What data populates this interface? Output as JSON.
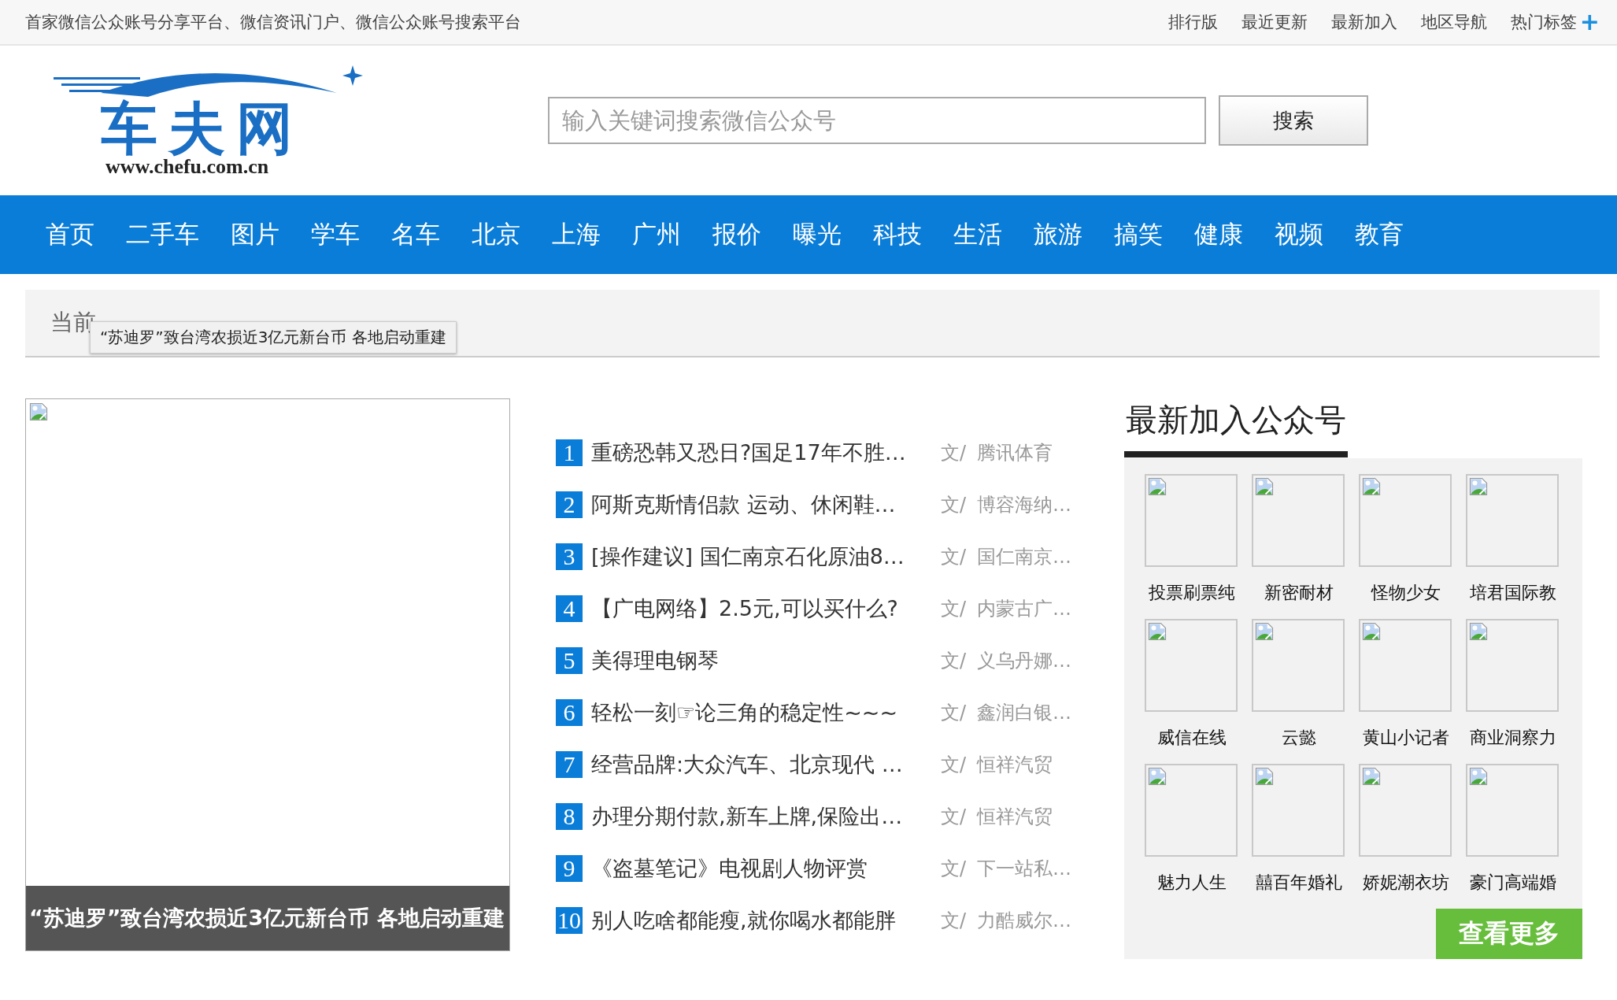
{
  "top_bar": {
    "slogan": "首家微信公众账号分享平台、微信资讯门户、微信公众账号搜索平台",
    "links": [
      "排行版",
      "最近更新",
      "最新加入",
      "地区导航",
      "热门标签"
    ],
    "plus": "+"
  },
  "logo": {
    "name": "车夫网",
    "url": "www.chefu.com.cn"
  },
  "search": {
    "placeholder": "输入关键词搜索微信公众号",
    "button": "搜索"
  },
  "nav": [
    "首页",
    "二手车",
    "图片",
    "学车",
    "名车",
    "北京",
    "上海",
    "广州",
    "报价",
    "曝光",
    "科技",
    "生活",
    "旅游",
    "搞笑",
    "健康",
    "视频",
    "教育"
  ],
  "breadcrumb": {
    "visible_text": "当前",
    "tooltip": "“苏迪罗”致台湾农损近3亿元新台币 各地启动重建"
  },
  "featured": {
    "caption": "“苏迪罗”致台湾农损近3亿元新台币 各地启动重建"
  },
  "news": [
    {
      "rank": "1",
      "title": "重磅恐韩又恐日?国足17年不胜…",
      "by": "文/",
      "source": "腾讯体育"
    },
    {
      "rank": "2",
      "title": "阿斯克斯情侣款 运动、休闲鞋…",
      "by": "文/",
      "source": "博容海纳…"
    },
    {
      "rank": "3",
      "title": "[操作建议] 国仁南京石化原油8…",
      "by": "文/",
      "source": "国仁南京…"
    },
    {
      "rank": "4",
      "title": "【广电网络】2.5元,可以买什么?",
      "by": "文/",
      "source": "内蒙古广…"
    },
    {
      "rank": "5",
      "title": "美得理电钢琴",
      "by": "文/",
      "source": "义乌丹娜…"
    },
    {
      "rank": "6",
      "title": "轻松一刻☞论三角的稳定性~~~",
      "by": "文/",
      "source": "鑫润白银…"
    },
    {
      "rank": "7",
      "title": "经营品牌:大众汽车、北京现代 …",
      "by": "文/",
      "source": "恒祥汽贸"
    },
    {
      "rank": "8",
      "title": "办理分期付款,新车上牌,保险出…",
      "by": "文/",
      "source": "恒祥汽贸"
    },
    {
      "rank": "9",
      "title": "《盗墓笔记》电视剧人物评赏",
      "by": "文/",
      "source": "下一站私…"
    },
    {
      "rank": "10",
      "title": "别人吃啥都能瘦,就你喝水都能胖",
      "by": "文/",
      "source": "力酷威尔…"
    }
  ],
  "latest": {
    "title": "最新加入公众号",
    "accounts": [
      "投票刷票纯",
      "新密耐材",
      "怪物少女",
      "培君国际教",
      "威信在线",
      "云懿",
      "黄山小记者",
      "商业洞察力",
      "魅力人生",
      "囍百年婚礼",
      "娇妮潮衣坊",
      "豪门高端婚"
    ],
    "more": "查看更多"
  }
}
